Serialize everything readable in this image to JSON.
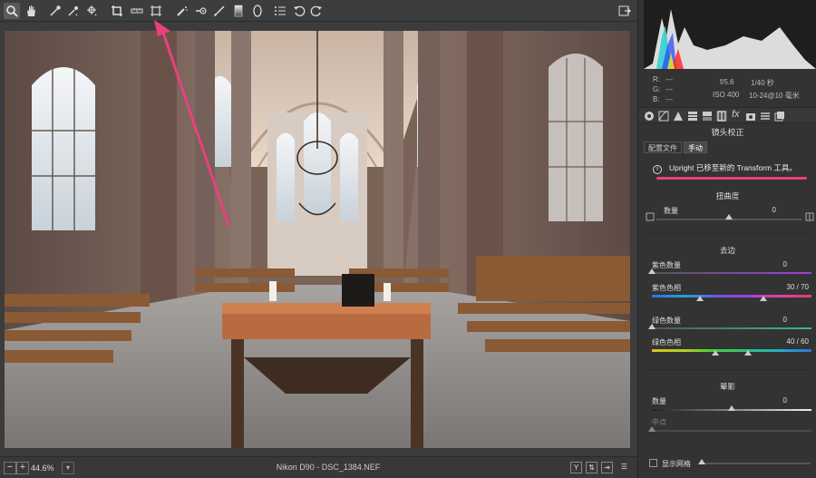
{
  "app": {
    "toolbar": {
      "tools": [
        {
          "name": "zoom-tool",
          "icon": "magnifier-icon"
        },
        {
          "name": "hand-tool",
          "icon": "hand-icon"
        },
        {
          "name": "white-balance-tool",
          "icon": "eyedropper-icon"
        },
        {
          "name": "color-sampler-tool",
          "icon": "sampler-icon"
        },
        {
          "name": "targeted-adjustment-tool",
          "icon": "target-icon"
        },
        {
          "name": "crop-tool",
          "icon": "crop-icon"
        },
        {
          "name": "straighten-tool",
          "icon": "straighten-icon"
        },
        {
          "name": "transform-tool",
          "icon": "transform-icon"
        },
        {
          "name": "spot-removal-tool",
          "icon": "spot-icon"
        },
        {
          "name": "red-eye-tool",
          "icon": "redeye-icon"
        },
        {
          "name": "adjustment-brush-tool",
          "icon": "brush-icon"
        },
        {
          "name": "graduated-filter-tool",
          "icon": "gradient-icon"
        },
        {
          "name": "radial-filter-tool",
          "icon": "ellipse-icon"
        },
        {
          "name": "preferences-tool",
          "icon": "list-icon"
        },
        {
          "name": "rotate-left-tool",
          "icon": "rotate-ccw-icon"
        },
        {
          "name": "rotate-right-tool",
          "icon": "rotate-cw-icon"
        }
      ]
    },
    "status": {
      "zoom_value": "44.6%",
      "filename": "Nikon D90 -  DSC_1384.NEF",
      "view_y": "Y"
    },
    "histogram": {
      "r_label": "R:",
      "r_value": "---",
      "g_label": "G:",
      "g_value": "---",
      "b_label": "B:",
      "b_value": "---",
      "aperture": "f/5.6",
      "shutter": "1/40 秒",
      "iso": "ISO 400",
      "focal": "10-24@10 毫米"
    },
    "panel": {
      "title": "镜头校正",
      "tabs": [
        "配置文件",
        "手动"
      ],
      "active_tab": "手动",
      "info_text": "Upright 已移至新的 Transform 工具。",
      "distortion": {
        "title": "扭曲度",
        "amount_label": "数量",
        "amount_value": "0",
        "amount_level": 0.5
      },
      "defringe": {
        "title": "去边",
        "purple_amount_label": "紫色数量",
        "purple_amount_value": "0",
        "purple_amount_level": 0,
        "purple_hue_label": "紫色色相",
        "purple_hue_value": "30 / 70",
        "purple_hue_range": [
          30,
          70
        ],
        "green_amount_label": "绿色数量",
        "green_amount_value": "0",
        "green_amount_level": 0,
        "green_hue_label": "绿色色相",
        "green_hue_value": "40 / 60",
        "green_hue_range": [
          40,
          60
        ]
      },
      "vignette": {
        "title": "晕影",
        "amount_label": "数量",
        "amount_value": "0",
        "amount_level": 0.5,
        "midpoint_label": "中点",
        "midpoint_level": 0
      },
      "show_grid_label": "显示网格"
    },
    "colors": {
      "annotation": "#e84080",
      "purple_gradient": "#a040e0",
      "green_gradient": "#30c080"
    }
  }
}
